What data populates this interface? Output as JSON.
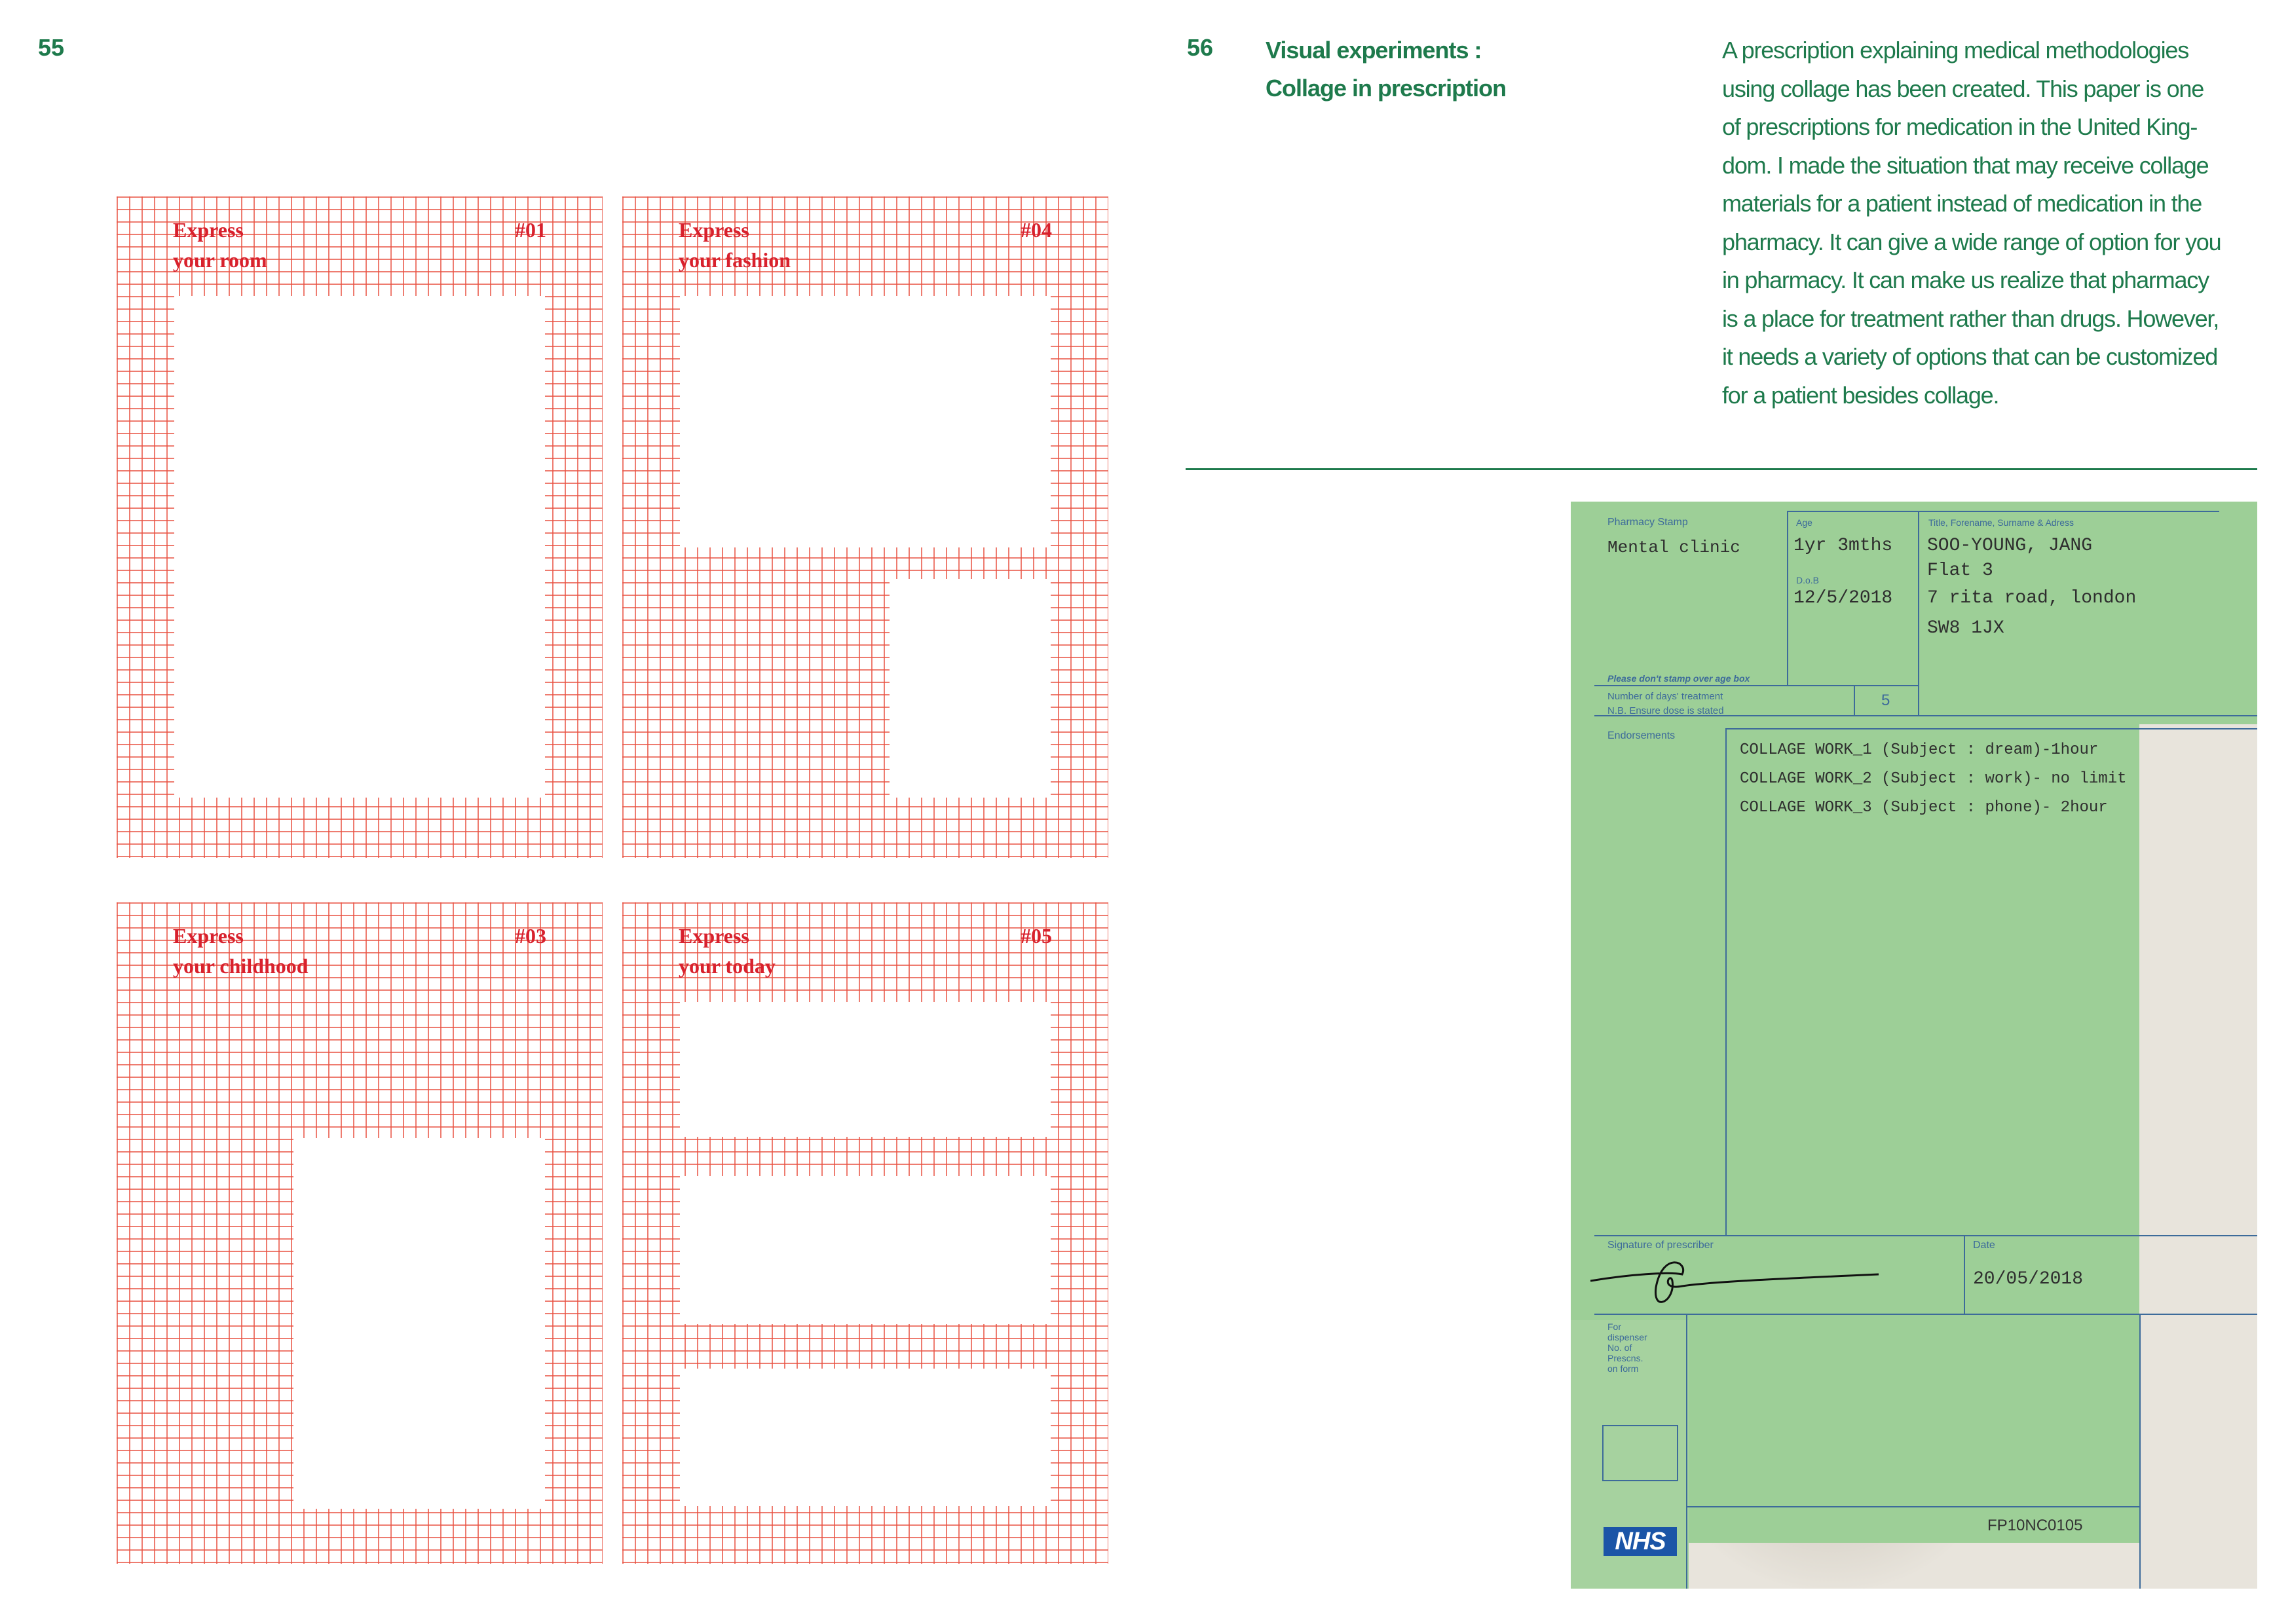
{
  "left_page": {
    "number": "55"
  },
  "right_page": {
    "number": "56",
    "heading": [
      "Visual experiments :",
      "Collage in prescription"
    ],
    "body_lines": [
      "A prescription explaining medical methodologies",
      "using collage has been created. This paper is one",
      "of prescriptions for medication in the United King-",
      "dom. I made the situation that may receive collage",
      "materials for a patient instead of medication in the",
      "pharmacy. It can give a wide range of option for you",
      "in pharmacy. It can make us realize that pharmacy",
      "is a place for treatment rather than drugs. However,",
      "it needs a variety of options that can be customized",
      "for a patient besides collage."
    ]
  },
  "panels": [
    {
      "line1": "Express",
      "line2": "your room",
      "num": "#01"
    },
    {
      "line1": "Express",
      "line2": "your fashion",
      "num": "#04"
    },
    {
      "line1": "Express",
      "line2": "your childhood",
      "num": "#03"
    },
    {
      "line1": "Express",
      "line2": "your today",
      "num": "#05"
    }
  ],
  "prescription": {
    "pharmacy_stamp_label": "Pharmacy Stamp",
    "pharmacy_stamp_value": "Mental clinic",
    "age_label": "Age",
    "age_value": "1yr 3mths",
    "dob_label": "D.o.B",
    "dob_value": "12/5/2018",
    "name_label": "Title, Forename, Surname & Adress",
    "name_lines": [
      "SOO-YOUNG, JANG",
      "Flat 3",
      "7 rita road, london",
      "SW8 1JX"
    ],
    "no_stamp_note": "Please don't stamp over age box",
    "days_label_1": "Number of days' treatment",
    "days_label_2": "N.B. Ensure dose is stated",
    "days_value": "5",
    "endorsements_label": "Endorsements",
    "items": [
      "COLLAGE WORK_1 (Subject : dream)-1hour",
      "COLLAGE WORK_2 (Subject : work)- no limit",
      "COLLAGE WORK_3 (Subject : phone)- 2hour"
    ],
    "signature_label": "Signature of prescriber",
    "date_label": "Date",
    "date_value": "20/05/2018",
    "dispenser_lines": [
      "For",
      "dispenser",
      "No. of",
      "Prescns.",
      "on form"
    ],
    "nhs_logo": "NHS",
    "form_code": "FP10NC0105"
  },
  "colors": {
    "accent_green": "#1e7a4c",
    "grid_red": "#e85040",
    "title_red": "#d8212d",
    "form_green": "#9dcf97",
    "form_blue": "#3d6b9a",
    "nhs_blue": "#1b55a7"
  }
}
